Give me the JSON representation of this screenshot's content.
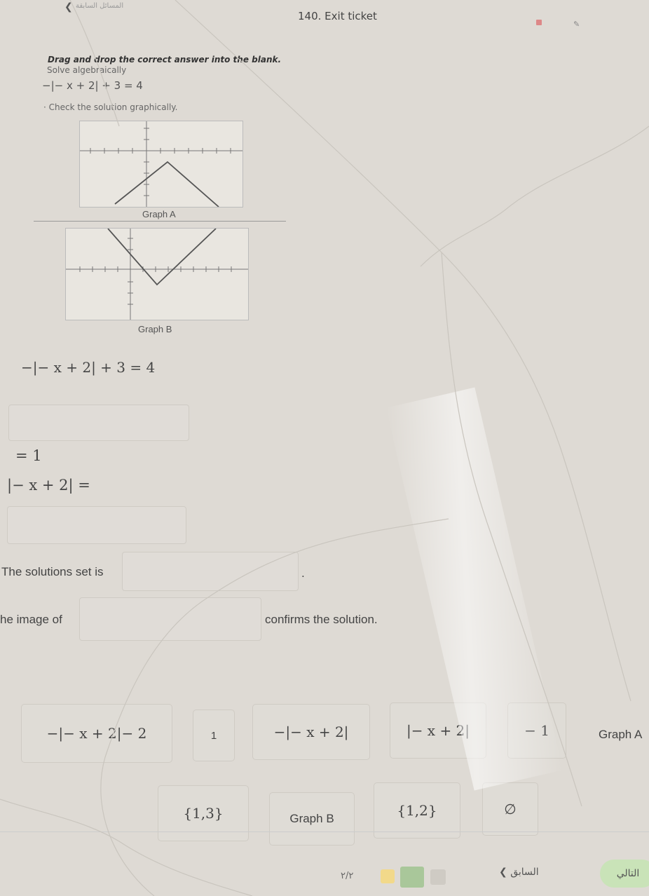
{
  "header": {
    "breadcrumb": "المسائل السابقة",
    "title": "140. Exit ticket"
  },
  "question": {
    "instruction": "Drag and drop the correct answer into the blank.",
    "solve_label": "Solve algebraically",
    "equation_small": "−|− x + 2| + 3 = 4",
    "check_label": "· Check the solution graphically."
  },
  "graphs": [
    {
      "label": "Graph A"
    },
    {
      "label": "Graph B"
    }
  ],
  "work": {
    "equation": "−|− x + 2| + 3 = 4",
    "eq_one": "= 1",
    "eq_abs": "|− x + 2| =",
    "solutions_label": "The solutions set is",
    "solutions_period": ".",
    "image_label": "he image of",
    "confirms_label": "confirms the solution."
  },
  "choices_row1": [
    {
      "name": "choice-neg-abs-minus-2",
      "label": "−|− x + 2|− 2"
    },
    {
      "name": "choice-one",
      "label": "1"
    },
    {
      "name": "choice-neg-abs",
      "label": "−|− x + 2|"
    },
    {
      "name": "choice-abs",
      "label": "|− x + 2|"
    },
    {
      "name": "choice-neg-one",
      "label": "− 1"
    },
    {
      "name": "choice-graph-a",
      "label": "Graph A"
    }
  ],
  "choices_row2": [
    {
      "name": "choice-set-1-3",
      "label": "{1,3}"
    },
    {
      "name": "choice-graph-b",
      "label": "Graph B"
    },
    {
      "name": "choice-set-1-2",
      "label": "{1,2}"
    },
    {
      "name": "choice-empty-set",
      "label": "∅"
    }
  ],
  "footer": {
    "pager": "٢/٢",
    "prev_label": "السابق",
    "next_label": "التالي"
  },
  "icons": {
    "back": "chevron-left-icon",
    "flag": "flag-icon",
    "pen": "pen-icon"
  },
  "colors": {
    "next_button": "#c9e3b8",
    "progress_active": "#a9c79a",
    "progress_yellow": "#f2d98a"
  }
}
